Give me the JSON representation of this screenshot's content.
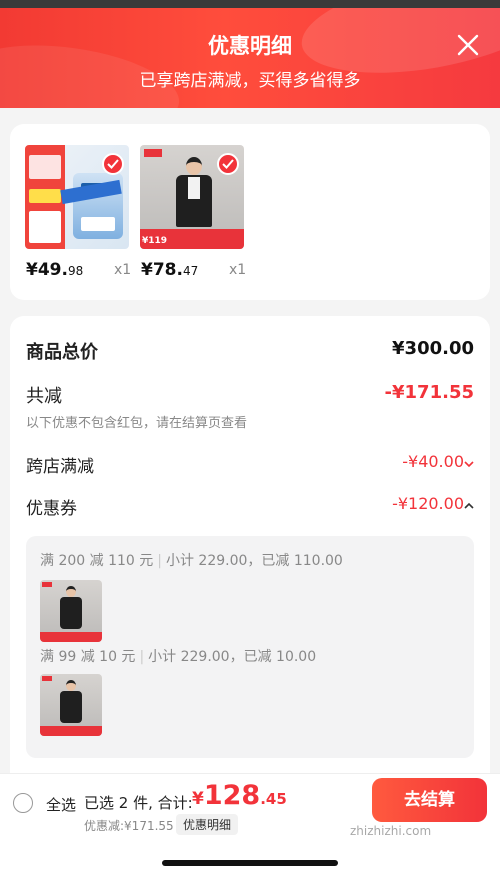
{
  "header": {
    "title": "优惠明细",
    "subtitle": "已享跨店满减，买得多省得多",
    "close_icon": "close-icon"
  },
  "items": [
    {
      "price_main": "¥49.",
      "price_frac": "98",
      "qty": "x1",
      "selected": true
    },
    {
      "price_main": "¥78.",
      "price_frac": "47",
      "qty": "x1",
      "selected": true,
      "thumb_price": "¥119"
    }
  ],
  "breakdown": {
    "total_label": "商品总价",
    "total_value": "¥300.00",
    "reduce_label": "共减",
    "reduce_value": "-¥171.55",
    "note": "以下优惠不包含红包，请在结算页查看",
    "cross_label": "跨店满减",
    "cross_value": "-¥40.00",
    "coupon_label": "优惠券",
    "coupon_value": "-¥120.00"
  },
  "coupons": [
    {
      "rule": "满 200 减 110 元",
      "detail": "小计 229.00，已减 110.00"
    },
    {
      "rule": "满 99 减 10 元",
      "detail": "小计 229.00，已减 10.00"
    }
  ],
  "bottom": {
    "select_all": "全选",
    "selected_text": "已选 2 件, 合计:",
    "total_yen": "¥",
    "total_main": "128",
    "total_frac": ".45",
    "discount_text": "优惠减:¥171.55",
    "detail_chip": "优惠明细",
    "checkout": "去结算"
  },
  "watermark": "zhizhizhi.com",
  "colors": {
    "accent": "#f2333a",
    "header": "#f23a33"
  }
}
